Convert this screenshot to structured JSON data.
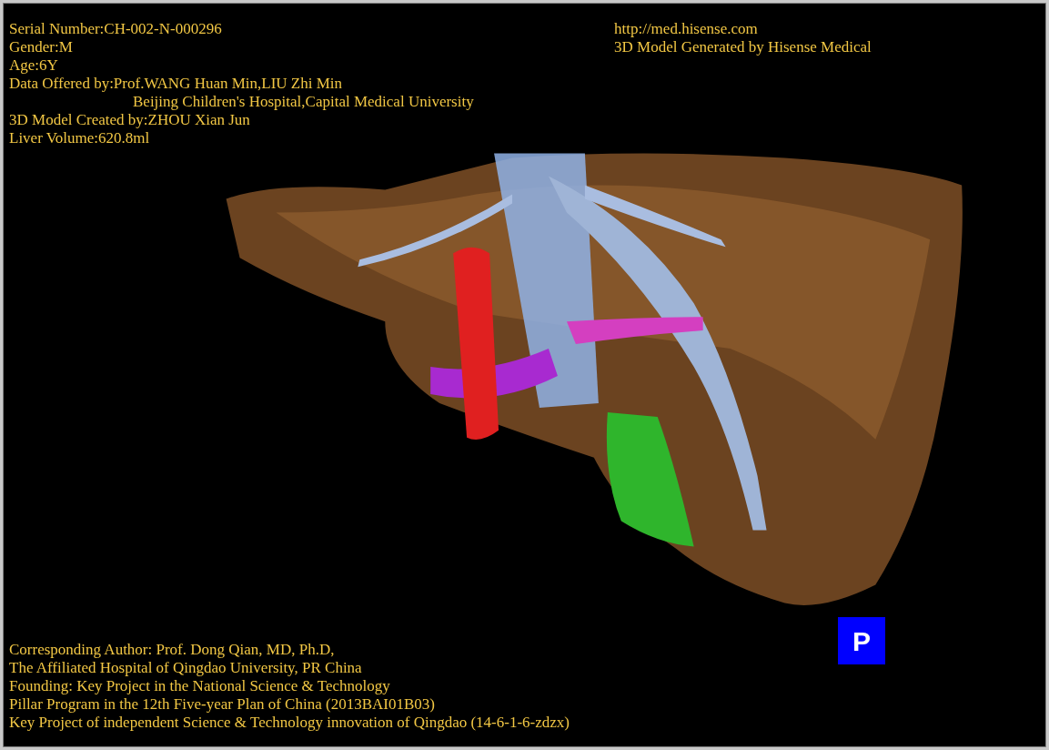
{
  "info_top_left": [
    {
      "kind": "line",
      "text": "Serial Number:CH-002-N-000296"
    },
    {
      "kind": "line",
      "text": "Gender:M"
    },
    {
      "kind": "line",
      "text": "Age:6Y"
    },
    {
      "kind": "line",
      "text": "Data Offered by:Prof.WANG Huan Min,LIU Zhi Min"
    },
    {
      "kind": "continuation",
      "text": "Beijing Children's Hospital,Capital Medical University"
    },
    {
      "kind": "line",
      "text": "3D Model Created by:ZHOU Xian Jun"
    },
    {
      "kind": "line",
      "text": "Liver Volume:620.8ml"
    }
  ],
  "info_top_right": [
    "http://med.hisense.com",
    "3D Model Generated by Hisense Medical"
  ],
  "info_bottom": [
    "Corresponding Author: Prof. Dong Qian, MD, Ph.D,",
    "The Affiliated Hospital of Qingdao University, PR China",
    "Founding: Key Project in the National Science & Technology",
    "Pillar Program in the 12th Five-year Plan of China (2013BAI01B03)",
    "Key Project of independent Science & Technology innovation of Qingdao (14-6-1-6-zdzx)"
  ],
  "view_badge": "P"
}
